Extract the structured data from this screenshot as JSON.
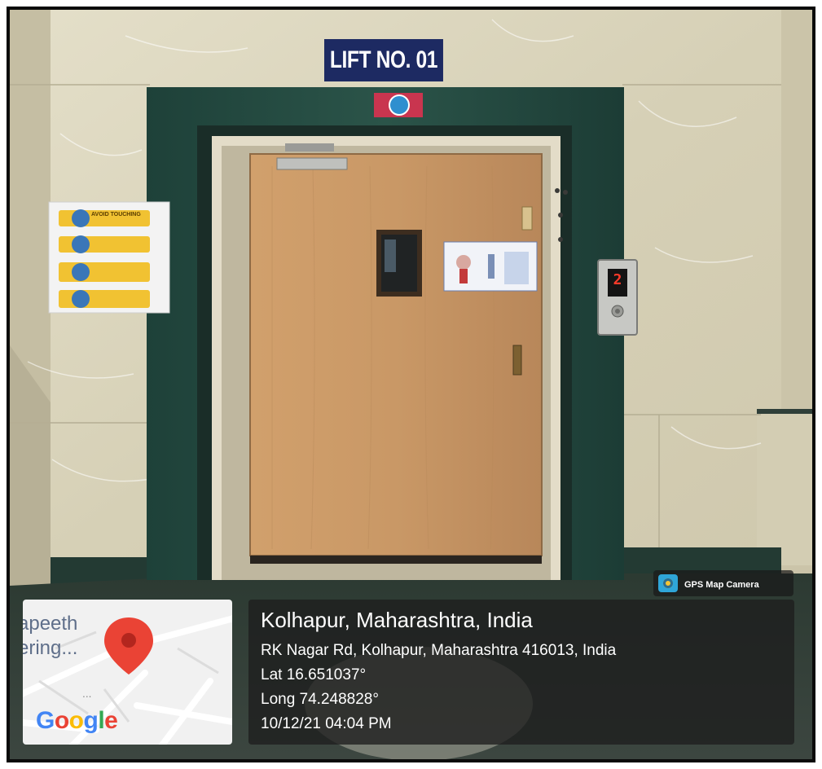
{
  "sign": {
    "text": "LIFT NO. 01"
  },
  "stickers": {
    "avoid_touching": "AVOID TOUCHING"
  },
  "lift_panel": {
    "floor_indicator": "2"
  },
  "gps_overlay": {
    "app_name": "GPS Map Camera",
    "map": {
      "place_line_1": "apeeth",
      "place_line_2": "ering...",
      "brand": [
        "G",
        "o",
        "o",
        "g",
        "l",
        "e"
      ],
      "brand_colors": [
        "#4285F4",
        "#EA4335",
        "#FBBC05",
        "#4285F4",
        "#34A853",
        "#EA4335"
      ],
      "pin_color": "#EA4335"
    },
    "location_title": "Kolhapur, Maharashtra, India",
    "address": "RK Nagar Rd, Kolhapur, Maharashtra 416013, India",
    "latitude": "Lat 16.651037°",
    "longitude": "Long 74.248828°",
    "datetime": "10/12/21 04:04 PM"
  },
  "colors": {
    "marble_wall": "#ddd8c2",
    "granite_frame": "#234a41",
    "door_wood": "#c99866",
    "sign_background": "#1d2a62"
  }
}
